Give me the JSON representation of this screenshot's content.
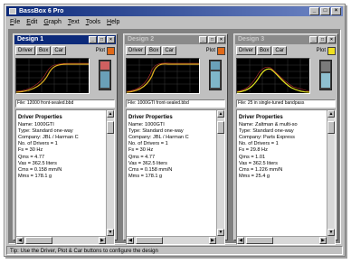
{
  "app": {
    "title": "BassBox 6 Pro"
  },
  "menu": [
    {
      "label": "File",
      "u": "F",
      "rest": "ile"
    },
    {
      "label": "Edit",
      "u": "E",
      "rest": "dit"
    },
    {
      "label": "Graph",
      "u": "G",
      "rest": "raph"
    },
    {
      "label": "Text",
      "u": "T",
      "rest": "ext"
    },
    {
      "label": "Tools",
      "u": "T",
      "rest": "ools"
    },
    {
      "label": "Help",
      "u": "H",
      "rest": "elp"
    }
  ],
  "buttons": {
    "driver": "Driver",
    "box": "Box",
    "car": "Car",
    "plot": "Plot"
  },
  "designs": [
    {
      "title": "Design 1",
      "plot_color": "#e06a1a",
      "curve_color": "#e0b020",
      "file": "File: 12000 front-sealed.bbd",
      "props_title": "Driver Properties",
      "lines": [
        "Name: 1000GTI",
        "Type: Standard one-way",
        "Company: JBL / Harman C",
        "No. of Drivers = 1",
        "Fs = 30 Hz",
        "Qms = 4.77",
        "Vas = 362.5 liters",
        "Cms = 0.158 mm/N",
        "Mms = 178.1 g"
      ]
    },
    {
      "title": "Design 2",
      "plot_color": "#e06a1a",
      "curve_color": "#e0b020",
      "file": "File: 1000GTI front-sealed.bbd",
      "props_title": "Driver Properties",
      "lines": [
        "Name: 1000GTI",
        "Type: Standard one-way",
        "Company: JBL / Harman C",
        "No. of Drivers = 1",
        "Fs = 30 Hz",
        "Qms = 4.77",
        "Vas = 362.5 liters",
        "Cms = 0.158 mm/N",
        "Mms = 178.1 g"
      ]
    },
    {
      "title": "Design 3",
      "plot_color": "#f0e020",
      "curve_color": "#e8e820",
      "file": "File: 25 in single-tuned bandpass",
      "props_title": "Driver Properties",
      "lines": [
        "Name: Zaltman & multi-so",
        "Type: Standard one-way",
        "Company: Parts Express",
        "No. of Drivers = 1",
        "Fs = 29.8 Hz",
        "Qms = 1.01",
        "Vas = 362.5 liters",
        "Cms = 1.226 mm/N",
        "Mms = 25.4 g"
      ]
    }
  ],
  "status": "Tip: Use the Driver, Plot & Car buttons to configure the design"
}
